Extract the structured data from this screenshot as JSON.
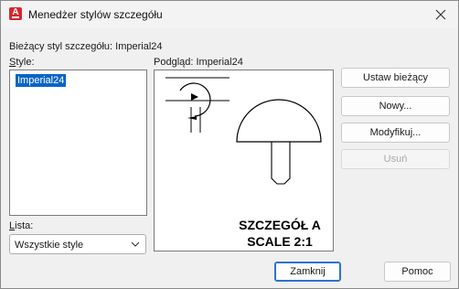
{
  "window": {
    "title": "Menedżer stylów szczegółu",
    "icon": "autocad-app-icon",
    "icon_letter": "A"
  },
  "current_style": {
    "label": "Bieżący styl szczegółu: Imperial24"
  },
  "styles": {
    "label": "Style:",
    "items": [
      "Imperial24"
    ],
    "selected": "Imperial24"
  },
  "preview": {
    "label": "Podgląd: Imperial24",
    "caption_line1": "SZCZEGÓŁ A",
    "caption_line2": "SCALE 2:1"
  },
  "list_filter": {
    "label": "Lista:",
    "value": "Wszystkie style"
  },
  "buttons": {
    "set_current": "Ustaw bieżący",
    "new": "Nowy...",
    "modify": "Modyfikuj...",
    "delete": "Usuń",
    "close": "Zamknij",
    "help": "Pomoc"
  },
  "colors": {
    "accent": "#0a64c8",
    "app_icon": "#d6272d",
    "default_button_border": "#2f6fd1"
  }
}
